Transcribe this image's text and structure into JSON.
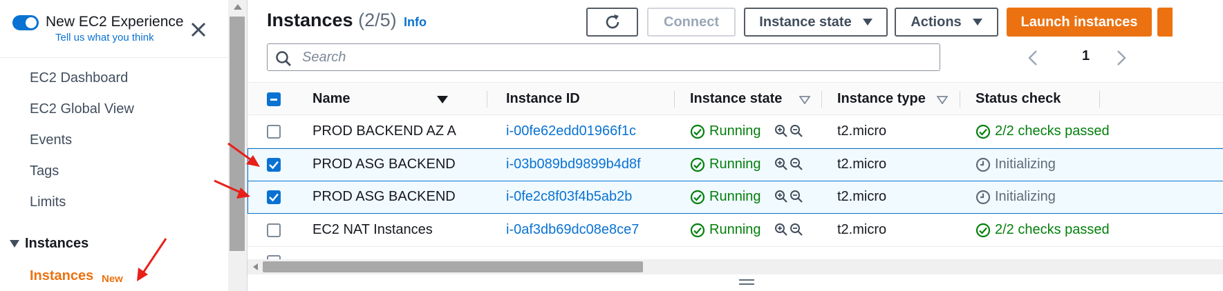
{
  "sidebar": {
    "toggle_title": "New EC2 Experience",
    "toggle_link": "Tell us what you think",
    "items": [
      {
        "label": "EC2 Dashboard"
      },
      {
        "label": "EC2 Global View"
      },
      {
        "label": "Events"
      },
      {
        "label": "Tags"
      },
      {
        "label": "Limits"
      }
    ],
    "section_label": "Instances",
    "active_item": "Instances",
    "active_badge": "New"
  },
  "header": {
    "title": "Instances",
    "count": "(2/5)",
    "info": "Info"
  },
  "toolbar": {
    "connect_label": "Connect",
    "instance_state_label": "Instance state",
    "actions_label": "Actions",
    "launch_label": "Launch instances"
  },
  "search": {
    "placeholder": "Search"
  },
  "pager": {
    "current_page": "1"
  },
  "table": {
    "columns": [
      "Name",
      "Instance ID",
      "Instance state",
      "Instance type",
      "Status check"
    ],
    "rows": [
      {
        "name": "PROD BACKEND AZ A",
        "id": "i-00fe62edd01966f1c",
        "state": "Running",
        "type": "t2.micro",
        "status": "2/2 checks passed",
        "status_kind": "ok",
        "selected": false
      },
      {
        "name": "PROD ASG BACKEND",
        "id": "i-03b089bd9899b4d8f",
        "state": "Running",
        "type": "t2.micro",
        "status": "Initializing",
        "status_kind": "init",
        "selected": true
      },
      {
        "name": "PROD ASG BACKEND",
        "id": "i-0fe2c8f03f4b5ab2b",
        "state": "Running",
        "type": "t2.micro",
        "status": "Initializing",
        "status_kind": "init",
        "selected": true
      },
      {
        "name": "EC2 NAT Instances",
        "id": "i-0af3db69dc08e8ce7",
        "state": "Running",
        "type": "t2.micro",
        "status": "2/2 checks passed",
        "status_kind": "ok",
        "selected": false
      }
    ]
  },
  "colors": {
    "accent": "#0972d3",
    "brand_orange": "#ec7211",
    "success": "#037f0c",
    "annotation_red": "#e8201a"
  }
}
